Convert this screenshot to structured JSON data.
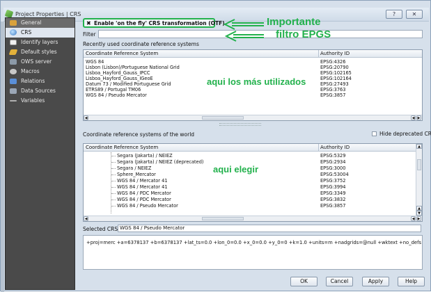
{
  "window": {
    "title": "Project Properties | CRS",
    "help_label": "?",
    "close_label": "✕"
  },
  "sidebar": {
    "items": [
      {
        "label": "General",
        "icon": "general-icon"
      },
      {
        "label": "CRS",
        "icon": "crs-globe-icon"
      },
      {
        "label": "Identify layers",
        "icon": "identify-layers-icon"
      },
      {
        "label": "Default styles",
        "icon": "default-styles-icon"
      },
      {
        "label": "OWS server",
        "icon": "ows-server-icon"
      },
      {
        "label": "Macros",
        "icon": "macros-icon"
      },
      {
        "label": "Relations",
        "icon": "relations-icon"
      },
      {
        "label": "Data Sources",
        "icon": "data-sources-icon"
      },
      {
        "label": "Variables",
        "icon": "variables-icon"
      }
    ]
  },
  "otf": {
    "label": "Enable 'on the fly' CRS transformation (OTF)",
    "checked_mark": "✖"
  },
  "annotations": {
    "importante": "Importante",
    "filtro": "filtro EPGS",
    "mas_utilizados": "aqui los más utilizados",
    "elegir": "aqui elegir",
    "color": "#22b14c"
  },
  "filter": {
    "label": "Filter",
    "value": ""
  },
  "recent": {
    "section_label": "Recently used coordinate reference systems",
    "col_crs": "Coordinate Reference System",
    "col_auth": "Authority ID",
    "rows": [
      {
        "crs": "WGS 84",
        "auth": "EPSG:4326"
      },
      {
        "crs": "Lisbon (Lisbon)/Portuguese National Grid",
        "auth": "EPSG:20790"
      },
      {
        "crs": "Lisboa_Hayford_Gauss_IPCC",
        "auth": "EPSG:102165"
      },
      {
        "crs": "Lisboa_Hayford_Gauss_IGeoE",
        "auth": "EPSG:102164"
      },
      {
        "crs": "Datum 73 / Modified Portuguese Grid",
        "auth": "EPSG:27493"
      },
      {
        "crs": "ETRS89 / Portugal TM06",
        "auth": "EPSG:3763"
      },
      {
        "crs": "WGS 84 / Pseudo Mercator",
        "auth": "EPSG:3857"
      }
    ]
  },
  "world": {
    "section_label": "Coordinate reference systems of the world",
    "hide_deprecated_label": "Hide deprecated CRSs",
    "col_crs": "Coordinate Reference System",
    "col_auth": "Authority ID",
    "rows": [
      {
        "crs": "Segara (Jakarta) / NEIEZ",
        "auth": "EPSG:5329"
      },
      {
        "crs": "Segara (Jakarta) / NEIEZ (deprecated)",
        "auth": "EPSG:2934"
      },
      {
        "crs": "Segara / NEIEZ",
        "auth": "EPSG:3000"
      },
      {
        "crs": "Sphere_Mercator",
        "auth": "EPSG:53004"
      },
      {
        "crs": "WGS 84 / Mercator 41",
        "auth": "EPSG:3752"
      },
      {
        "crs": "WGS 84 / Mercator 41",
        "auth": "EPSG:3994"
      },
      {
        "crs": "WGS 84 / PDC Mercator",
        "auth": "EPSG:3349"
      },
      {
        "crs": "WGS 84 / PDC Mercator",
        "auth": "EPSG:3832"
      },
      {
        "crs": "WGS 84 / Pseudo Mercator",
        "auth": "EPSG:3857"
      }
    ]
  },
  "selected": {
    "label": "Selected CRS:",
    "value": "WGS 84 / Pseudo Mercator"
  },
  "proj_string": "+proj=merc +a=6378137 +b=6378137 +lat_ts=0.0 +lon_0=0.0 +x_0=0.0 +y_0=0 +k=1.0 +units=m +nadgrids=@null +wktext +no_defs",
  "buttons": {
    "ok": "OK",
    "cancel": "Cancel",
    "apply": "Apply",
    "help": "Help"
  }
}
